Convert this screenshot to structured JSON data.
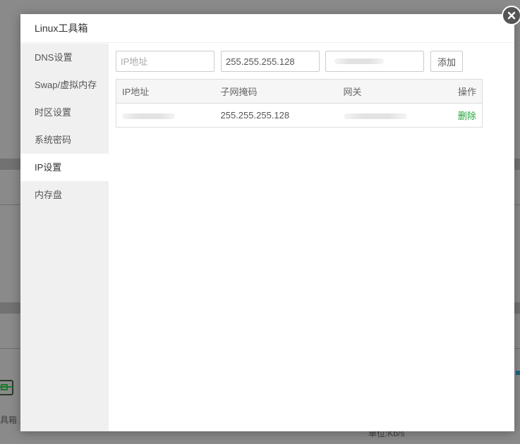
{
  "background": {
    "toolbox_label": "具箱 1",
    "unit_label": "单位:Kb/s"
  },
  "dialog": {
    "title": "Linux工具箱"
  },
  "sidebar": {
    "items": [
      {
        "label": "DNS设置"
      },
      {
        "label": "Swap/虚拟内存"
      },
      {
        "label": "时区设置"
      },
      {
        "label": "系统密码"
      },
      {
        "label": "IP设置",
        "active": true
      },
      {
        "label": "内存盘"
      }
    ]
  },
  "ip_form": {
    "ip_placeholder": "IP地址",
    "mask_value": "255.255.255.128",
    "gateway_value": "",
    "add_label": "添加"
  },
  "ip_table": {
    "headers": [
      "IP地址",
      "子网掩码",
      "网关",
      "操作"
    ],
    "rows": [
      {
        "ip": "",
        "mask": "255.255.255.128",
        "gateway": "",
        "action": "删除"
      }
    ]
  },
  "colors": {
    "accent": "#20a53a"
  }
}
